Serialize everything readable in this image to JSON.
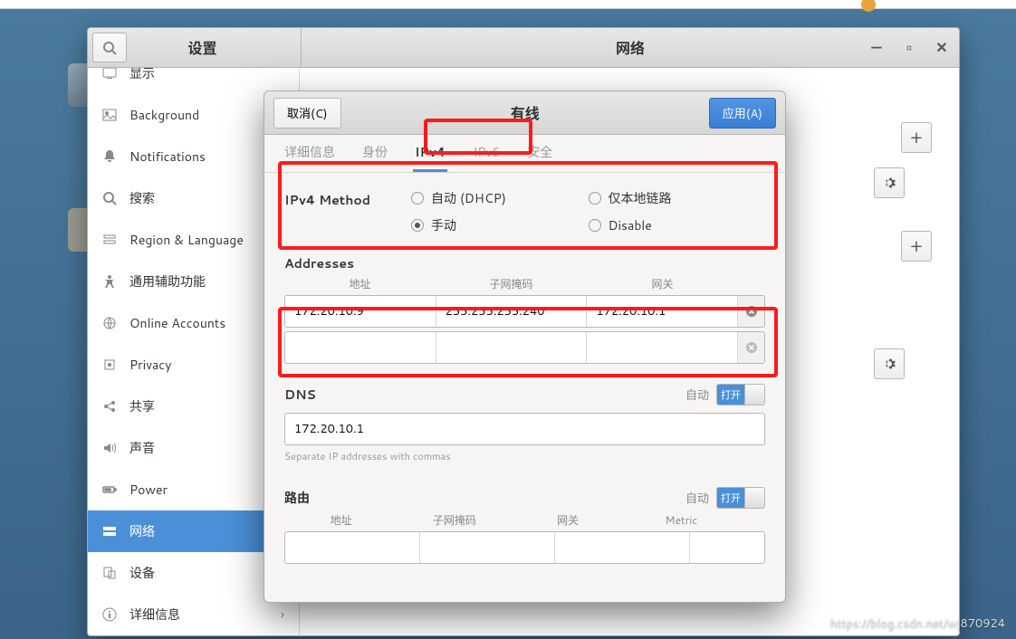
{
  "settings": {
    "title_left": "设置",
    "title_right": "网络",
    "sidebar": [
      {
        "icon": "display",
        "label": "显示"
      },
      {
        "icon": "background",
        "label": "Background"
      },
      {
        "icon": "notifications",
        "label": "Notifications"
      },
      {
        "icon": "search",
        "label": "搜索"
      },
      {
        "icon": "region",
        "label": "Region & Language"
      },
      {
        "icon": "accessibility",
        "label": "通用辅助功能"
      },
      {
        "icon": "online",
        "label": "Online Accounts"
      },
      {
        "icon": "privacy",
        "label": "Privacy"
      },
      {
        "icon": "sharing",
        "label": "共享"
      },
      {
        "icon": "sound",
        "label": "声音"
      },
      {
        "icon": "power",
        "label": "Power"
      },
      {
        "icon": "network",
        "label": "网络",
        "active": true
      },
      {
        "icon": "devices",
        "label": "设备",
        "chevron": true
      },
      {
        "icon": "details",
        "label": "详细信息",
        "chevron": true
      }
    ]
  },
  "dialog": {
    "cancel": "取消(C)",
    "apply": "应用(A)",
    "title": "有线",
    "tabs": [
      "详细信息",
      "身份",
      "IPv4",
      "IPv6",
      "安全"
    ],
    "active_tab": "IPv4",
    "method_label": "IPv4 Method",
    "methods": {
      "auto": "自动 (DHCP)",
      "local": "仅本地链路",
      "manual": "手动",
      "disable": "Disable"
    },
    "selected_method": "manual",
    "addresses": {
      "title": "Addresses",
      "cols": {
        "addr": "地址",
        "mask": "子网掩码",
        "gw": "网关"
      },
      "rows": [
        {
          "addr": "172.20.10.9",
          "mask": "255.255.255.240",
          "gw": "172.20.10.1"
        },
        {
          "addr": "",
          "mask": "",
          "gw": ""
        }
      ]
    },
    "dns": {
      "title": "DNS",
      "auto": "自动",
      "switch": "打开",
      "value": "172.20.10.1",
      "hint": "Separate IP addresses with commas"
    },
    "routes": {
      "title": "路由",
      "auto": "自动",
      "switch": "打开",
      "cols": {
        "addr": "地址",
        "mask": "子网掩码",
        "gw": "网关",
        "metric": "Metric"
      }
    }
  },
  "watermark": "https://blog.csdn.net/wj870924"
}
